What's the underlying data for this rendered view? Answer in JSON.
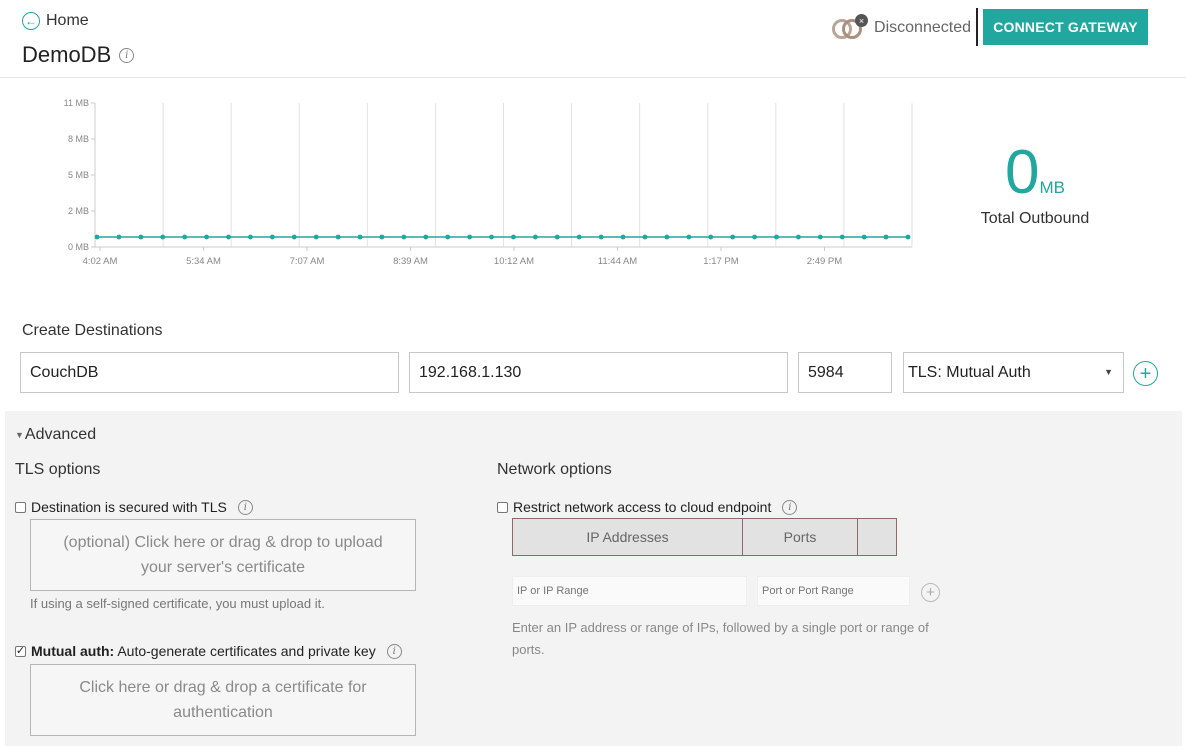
{
  "header": {
    "home_label": "Home",
    "db_name": "DemoDB",
    "status_label": "Disconnected",
    "connect_button": "CONNECT GATEWAY"
  },
  "colors": {
    "accent": "#21a79e",
    "panel_bg": "#f3f3f3"
  },
  "chart_data": {
    "type": "line",
    "y_ticks": [
      "11 MB",
      "8 MB",
      "5 MB",
      "2 MB",
      "0 MB"
    ],
    "x_ticks": [
      "4:02 AM",
      "5:34 AM",
      "7:07 AM",
      "8:39 AM",
      "10:12 AM",
      "11:44 AM",
      "1:17 PM",
      "2:49 PM"
    ],
    "ylim": [
      0,
      11
    ],
    "unit": "MB",
    "series": [
      {
        "values": [
          0,
          0,
          0,
          0,
          0,
          0,
          0,
          0,
          0,
          0,
          0,
          0,
          0,
          0,
          0,
          0,
          0,
          0,
          0,
          0,
          0,
          0,
          0,
          0,
          0,
          0,
          0,
          0,
          0,
          0,
          0,
          0,
          0,
          0,
          0,
          0,
          0,
          0
        ]
      }
    ],
    "grid": "vertical"
  },
  "total": {
    "value": "0",
    "unit": "MB",
    "label": "Total Outbound"
  },
  "destinations": {
    "title": "Create Destinations",
    "name_value": "CouchDB",
    "host_value": "192.168.1.130",
    "port_value": "5984",
    "security_selected": "TLS: Mutual Auth"
  },
  "advanced": {
    "toggle_label": "Advanced",
    "tls": {
      "title": "TLS options",
      "secured_label": "Destination is secured with TLS",
      "secured_checked": false,
      "upload_text": "(optional) Click here or drag & drop to upload your server's certificate",
      "upload_hint": "If using a self-signed certificate, you must upload it.",
      "mutual_bold": "Mutual auth:",
      "mutual_rest": " Auto-generate certificates and private key",
      "mutual_checked": true,
      "mutual_drop_text": "Click here or drag & drop a certificate for authentication"
    },
    "network": {
      "title": "Network options",
      "restrict_label": "Restrict network access to cloud endpoint",
      "restrict_checked": false,
      "col_ip": "IP Addresses",
      "col_ports": "Ports",
      "ip_placeholder": "IP or IP Range",
      "port_placeholder": "Port or Port Range",
      "hint": "Enter an IP address or range of IPs, followed by a single port or range of ports."
    }
  }
}
